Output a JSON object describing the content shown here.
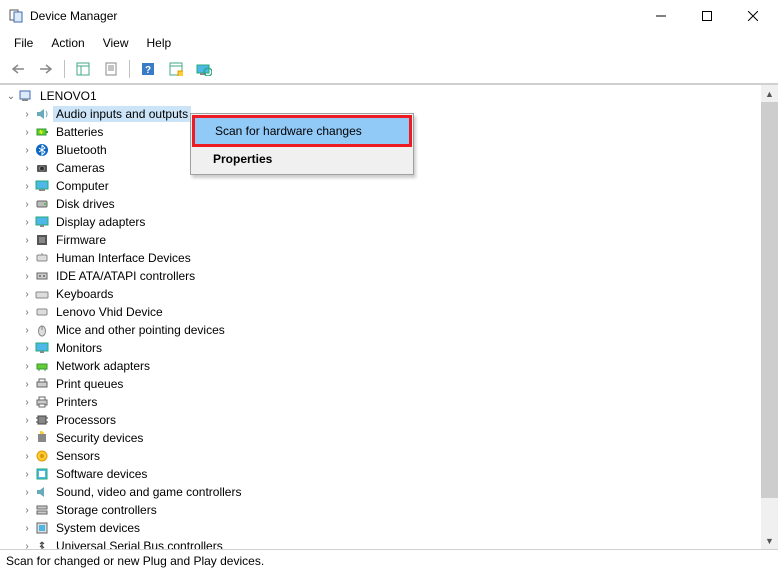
{
  "window": {
    "title": "Device Manager"
  },
  "menubar": {
    "items": [
      "File",
      "Action",
      "View",
      "Help"
    ]
  },
  "tree": {
    "root": "LENOVO1",
    "nodes": [
      {
        "label": "Audio inputs and outputs",
        "icon": "speaker",
        "selected": true
      },
      {
        "label": "Batteries",
        "icon": "battery"
      },
      {
        "label": "Bluetooth",
        "icon": "bluetooth"
      },
      {
        "label": "Cameras",
        "icon": "camera"
      },
      {
        "label": "Computer",
        "icon": "computer"
      },
      {
        "label": "Disk drives",
        "icon": "disk"
      },
      {
        "label": "Display adapters",
        "icon": "display"
      },
      {
        "label": "Firmware",
        "icon": "firmware"
      },
      {
        "label": "Human Interface Devices",
        "icon": "hid"
      },
      {
        "label": "IDE ATA/ATAPI controllers",
        "icon": "ide"
      },
      {
        "label": "Keyboards",
        "icon": "keyboard"
      },
      {
        "label": "Lenovo Vhid Device",
        "icon": "lenovo"
      },
      {
        "label": "Mice and other pointing devices",
        "icon": "mouse"
      },
      {
        "label": "Monitors",
        "icon": "monitor"
      },
      {
        "label": "Network adapters",
        "icon": "network"
      },
      {
        "label": "Print queues",
        "icon": "printqueue"
      },
      {
        "label": "Printers",
        "icon": "printer"
      },
      {
        "label": "Processors",
        "icon": "cpu"
      },
      {
        "label": "Security devices",
        "icon": "security"
      },
      {
        "label": "Sensors",
        "icon": "sensor"
      },
      {
        "label": "Software devices",
        "icon": "software"
      },
      {
        "label": "Sound, video and game controllers",
        "icon": "sound"
      },
      {
        "label": "Storage controllers",
        "icon": "storage"
      },
      {
        "label": "System devices",
        "icon": "system"
      },
      {
        "label": "Universal Serial Bus controllers",
        "icon": "usb"
      }
    ]
  },
  "context_menu": {
    "items": [
      {
        "label": "Scan for hardware changes",
        "highlighted": true
      },
      {
        "label": "Properties",
        "bold": true
      }
    ]
  },
  "statusbar": {
    "text": "Scan for changed or new Plug and Play devices."
  }
}
